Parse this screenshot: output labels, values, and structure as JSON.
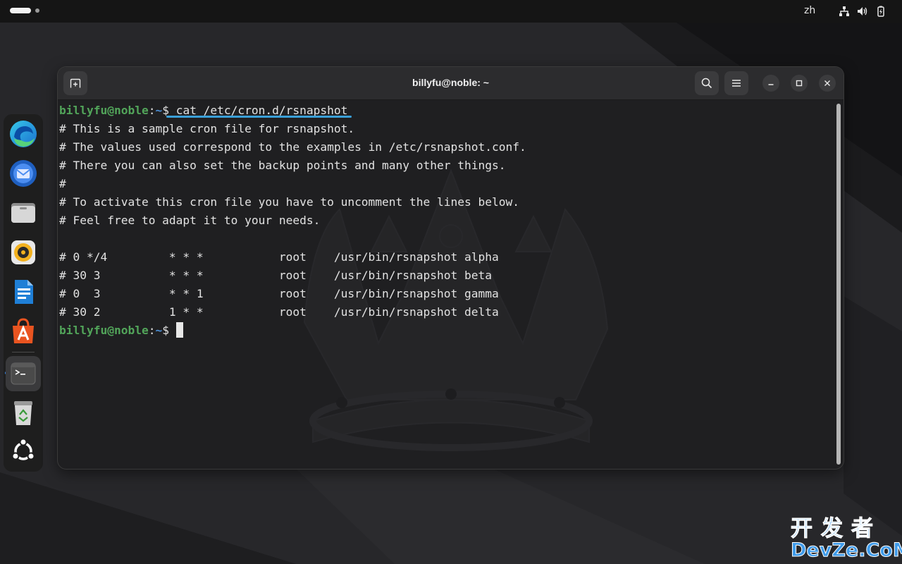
{
  "topbar": {
    "language": "zh",
    "icons": [
      "network-icon",
      "volume-icon",
      "battery-icon"
    ]
  },
  "dock": {
    "apps": [
      "edge-icon",
      "thunderbird-icon",
      "files-icon",
      "rhythmbox-icon",
      "writer-icon",
      "app-center-icon",
      "terminal-icon",
      "trash-icon",
      "ubuntu-icon"
    ],
    "active": "terminal-icon"
  },
  "window": {
    "title": "billyfu@noble: ~",
    "buttons": [
      "new-tab",
      "search",
      "menu",
      "minimize",
      "maximize",
      "close"
    ]
  },
  "terminal": {
    "prompt_user": "billyfu@noble",
    "prompt_colon": ":",
    "prompt_path": "~",
    "prompt_symbol": "$ ",
    "command": "cat /etc/cron.d/rsnapshot",
    "output": [
      "# This is a sample cron file for rsnapshot.",
      "# The values used correspond to the examples in /etc/rsnapshot.conf.",
      "# There you can also set the backup points and many other things.",
      "#",
      "# To activate this cron file you have to uncomment the lines below.",
      "# Feel free to adapt it to your needs.",
      "",
      "# 0 */4         * * *           root    /usr/bin/rsnapshot alpha",
      "# 30 3          * * *           root    /usr/bin/rsnapshot beta",
      "# 0  3          * * 1           root    /usr/bin/rsnapshot gamma",
      "# 30 2          1 * *           root    /usr/bin/rsnapshot delta"
    ]
  },
  "colors": {
    "prompt_user": "#52a55a",
    "prompt_path": "#4c8fd6",
    "highlight": "#3aa0d8"
  },
  "watermark": {
    "line1": "开发者",
    "line2": "DevZe.CoM"
  }
}
